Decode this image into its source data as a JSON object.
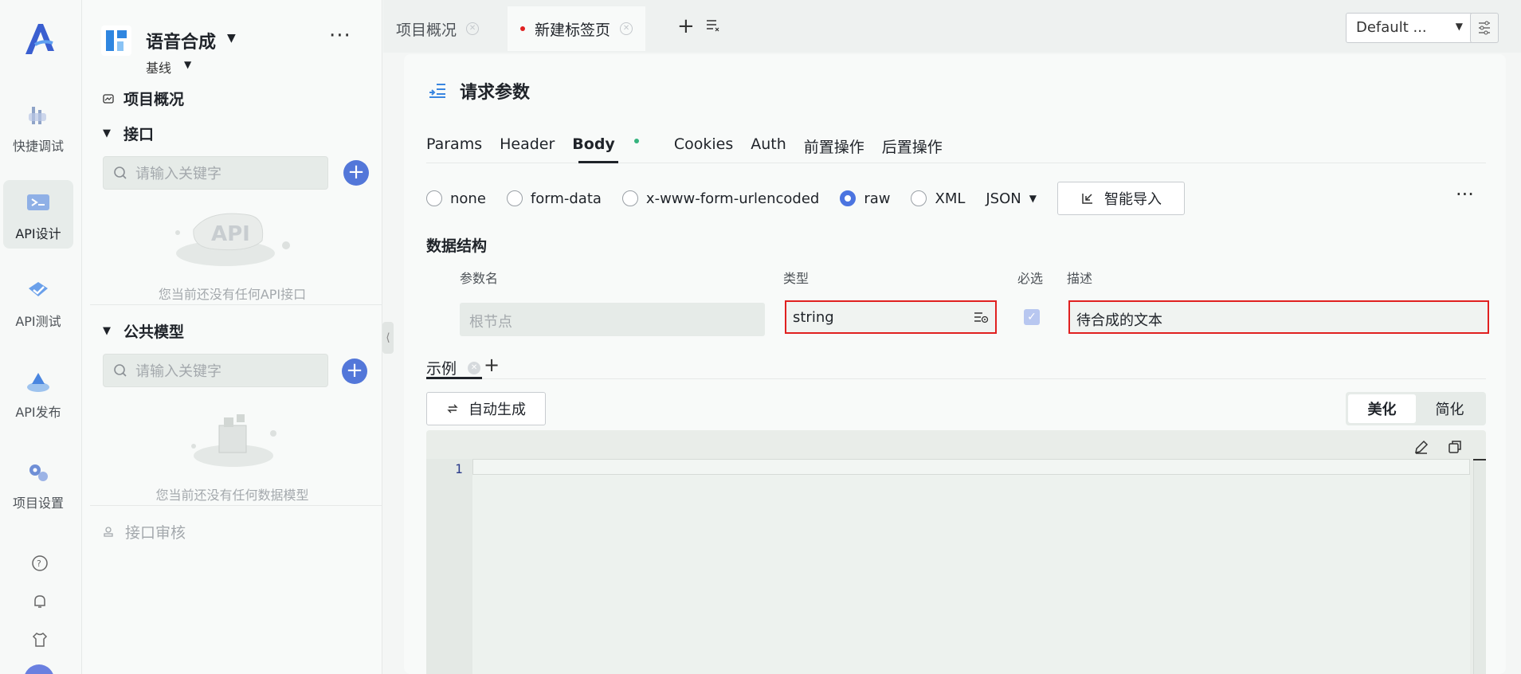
{
  "rail": {
    "items": [
      {
        "label": "快捷调试",
        "icon": "quick-debug-icon"
      },
      {
        "label": "API设计",
        "icon": "api-design-icon",
        "active": true
      },
      {
        "label": "API测试",
        "icon": "api-test-icon"
      },
      {
        "label": "API发布",
        "icon": "api-publish-icon"
      },
      {
        "label": "项目设置",
        "icon": "project-settings-icon"
      }
    ],
    "bottom_icons": [
      "help-icon",
      "bell-icon",
      "shirt-icon"
    ]
  },
  "sidebar": {
    "project_name": "语音合成",
    "branch": "基线",
    "overview": "项目概况",
    "interfaces": {
      "title": "接口",
      "search_placeholder": "请输入关键字",
      "empty_text": "您当前还没有任何API接口"
    },
    "models": {
      "title": "公共模型",
      "search_placeholder": "请输入关键字",
      "empty_text": "您当前还没有任何数据模型"
    },
    "review": "接口审核"
  },
  "tabs": [
    {
      "label": "项目概况",
      "active": false
    },
    {
      "label": "新建标签页",
      "active": true,
      "unsaved": true
    }
  ],
  "env": {
    "selected": "Default ..."
  },
  "panel": {
    "title": "请求参数",
    "subtabs": [
      "Params",
      "Header",
      "Body",
      "Cookies",
      "Auth",
      "前置操作",
      "后置操作"
    ],
    "active_subtab": "Body",
    "body_types": [
      "none",
      "form-data",
      "x-www-form-urlencoded",
      "raw",
      "XML"
    ],
    "selected_body_type": "raw",
    "format": "JSON",
    "smart_import": "智能导入",
    "schema": {
      "title": "数据结构",
      "headers": {
        "name": "参数名",
        "type": "类型",
        "required": "必选",
        "desc": "描述"
      },
      "root_placeholder": "根节点",
      "type_value": "string",
      "required_checked": true,
      "desc_value": "待合成的文本"
    },
    "example": {
      "tab": "示例",
      "auto_generate": "自动生成",
      "beautify": "美化",
      "simplify": "简化",
      "line_number": "1"
    }
  },
  "colors": {
    "accent": "#5377d9",
    "highlight_border": "#e02020",
    "status_dot": "#36b37e"
  }
}
